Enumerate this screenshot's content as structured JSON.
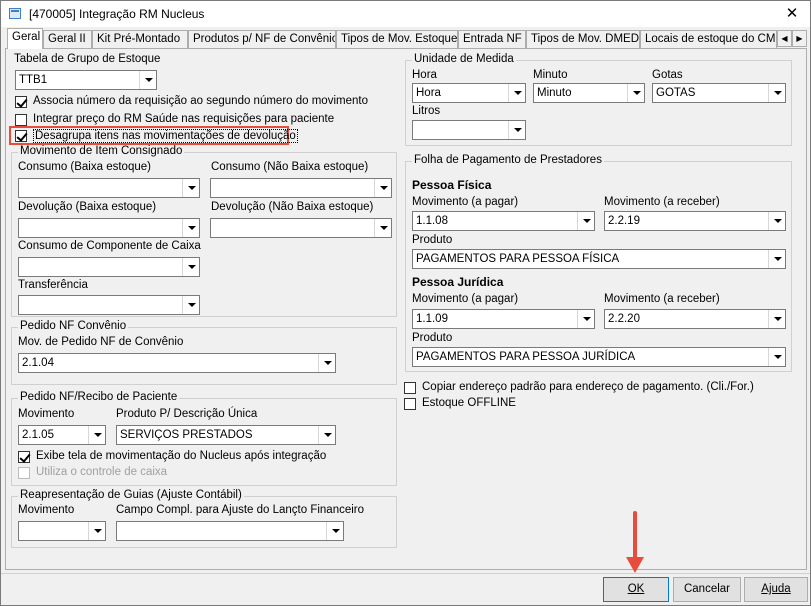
{
  "window": {
    "title": "[470005]  Integração RM Nucleus",
    "close": "✕"
  },
  "tabs": [
    "Geral",
    "Geral II",
    "Kit Pré-Montado",
    "Produtos p/ NF de Convênio",
    "Tipos de Mov. Estoque",
    "Entrada NF",
    "Tipos de Mov. DMED",
    "Locais de estoque do CME"
  ],
  "left": {
    "tabela_label": "Tabela de Grupo de Estoque",
    "tabela_value": "TTB1",
    "chk1": "Associa número da requisição ao segundo número do movimento",
    "chk2": "Integrar preço do RM Saúde nas requisições para paciente",
    "chk3": "Desagrupa itens nas movimentações de  devolução",
    "consig": {
      "title": "Movimento de Item Consignado",
      "consumo_baixa": "Consumo (Baixa estoque)",
      "consumo_nao": "Consumo (Não Baixa estoque)",
      "devol_baixa": "Devolução (Baixa estoque)",
      "devol_nao": "Devolução (Não Baixa estoque)",
      "comp_caixa": "Consumo de Componente de Caixa",
      "transf": "Transferência"
    },
    "pedido_nf": {
      "title": "Pedido NF Convênio",
      "label": "Mov. de Pedido NF de Convênio",
      "value": "2.1.04"
    },
    "pedido_recibo": {
      "title": "Pedido NF/Recibo de Paciente",
      "mov_label": "Movimento",
      "mov_value": "2.1.05",
      "prod_label": "Produto P/ Descrição Única",
      "prod_value": "SERVIÇOS PRESTADOS",
      "chk_exibe": "Exibe tela de movimentação do Nucleus após integração",
      "chk_caixa": "Utiliza o controle de caixa"
    },
    "reapres": {
      "title": "Reapresentação de Guias (Ajuste Contábil)",
      "mov_label": "Movimento",
      "campo_label": "Campo Compl. para Ajuste do Lançto Financeiro"
    }
  },
  "right": {
    "unidade": {
      "title": "Unidade de Medida",
      "hora_label": "Hora",
      "hora_value": "Hora",
      "minuto_label": "Minuto",
      "minuto_value": "Minuto",
      "gotas_label": "Gotas",
      "gotas_value": "GOTAS",
      "litros_label": "Litros"
    },
    "folha": {
      "title": "Folha de Pagamento de Prestadores",
      "pf": "Pessoa Física",
      "pf_pagar_label": "Movimento (a pagar)",
      "pf_pagar": "1.1.08",
      "pf_receber_label": "Movimento (a receber)",
      "pf_receber": "2.2.19",
      "pf_prod_label": "Produto",
      "pf_prod": "PAGAMENTOS PARA PESSOA FÍSICA",
      "pj": "Pessoa Jurídica",
      "pj_pagar_label": "Movimento (a pagar)",
      "pj_pagar": "1.1.09",
      "pj_receber_label": "Movimento (a receber)",
      "pj_receber": "2.2.20",
      "pj_prod_label": "Produto",
      "pj_prod": "PAGAMENTOS PARA PESSOA JURÍDICA"
    },
    "chk_copiar": "Copiar endereço padrão para endereço de pagamento. (Cli./For.)",
    "chk_offline": "Estoque OFFLINE"
  },
  "buttons": {
    "ok": "OK",
    "cancelar": "Cancelar",
    "ajuda": "Ajuda"
  },
  "colors": {
    "highlight": "#e84c3d",
    "arrow": "#e84c3d"
  }
}
